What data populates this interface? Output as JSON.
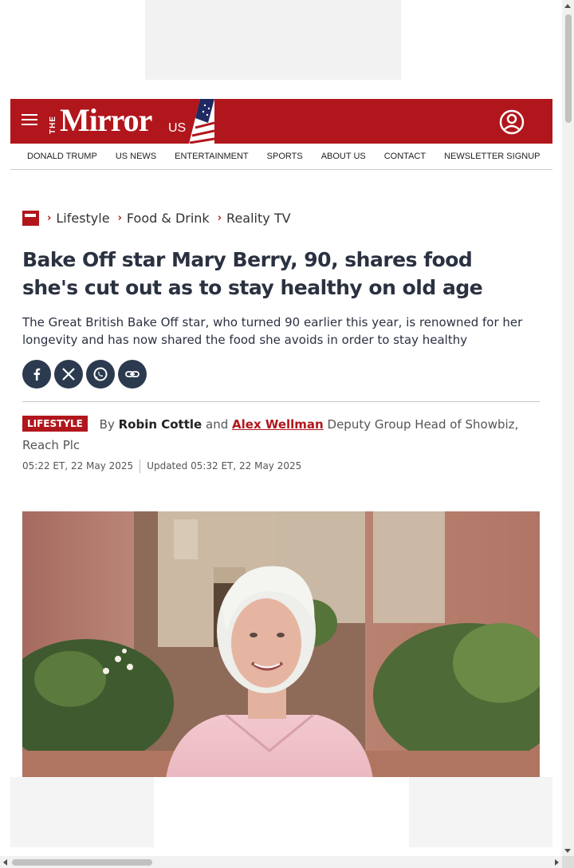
{
  "brand": {
    "logo_the": "THE",
    "logo_word": "Mirror",
    "logo_region": "US",
    "accent": "#b1161c"
  },
  "nav": [
    {
      "label": "DONALD TRUMP"
    },
    {
      "label": "US NEWS"
    },
    {
      "label": "ENTERTAINMENT"
    },
    {
      "label": "SPORTS"
    },
    {
      "label": "ABOUT US"
    },
    {
      "label": "CONTACT"
    },
    {
      "label": "NEWSLETTER SIGNUP"
    }
  ],
  "breadcrumb": [
    "Lifestyle",
    "Food & Drink",
    "Reality TV"
  ],
  "article": {
    "headline": "Bake Off star Mary Berry, 90, shares food she's cut out as to stay healthy on old age",
    "standfirst": "The Great British Bake Off star, who turned 90 earlier this year, is renowned for her longevity and has now shared the food she avoids in order to stay healthy",
    "tag": "LIFESTYLE",
    "by": "By",
    "author1": "Robin Cottle",
    "and": "and",
    "author2": "Alex Wellman",
    "author2_role": "Deputy Group Head of Showbiz, Reach Plc",
    "published": "05:22 ET, 22 May 2025",
    "updated": "Updated 05:32 ET, 22 May 2025"
  },
  "share": [
    {
      "icon": "facebook-icon",
      "color": "#2b3a4f"
    },
    {
      "icon": "x-icon",
      "color": "#2b3a4f"
    },
    {
      "icon": "whatsapp-icon",
      "color": "#2b3a4f"
    },
    {
      "icon": "copy-link-icon",
      "color": "#2b3a4f"
    }
  ]
}
